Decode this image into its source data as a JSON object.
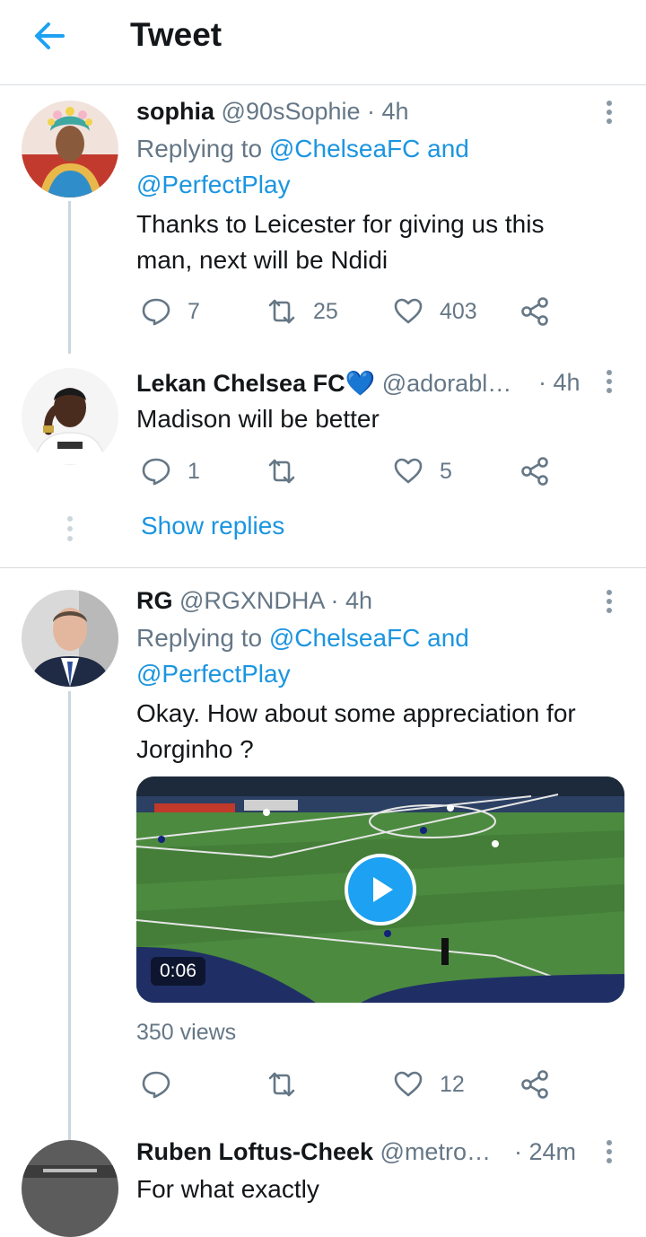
{
  "header": {
    "title": "Tweet"
  },
  "tweets": [
    {
      "name": "sophia",
      "handle": "@90sSophie · 4h",
      "reply_prefix": "Replying to",
      "reply_mention": "@ChelseaFC and",
      "reply_mention2": "@PerfectPlay",
      "text_line1": "Thanks to Leicester for giving us this",
      "text_line2": "man, next will be Ndidi",
      "replies": "7",
      "retweets": "25",
      "likes": "403"
    },
    {
      "name": "Lekan Chelsea FC",
      "name_emoji": "💙",
      "handle": "@adorabl…",
      "time": "· 4h",
      "text_line1": "Madison will be better",
      "replies": "1",
      "retweets": "",
      "likes": "5"
    },
    {
      "name": "RG",
      "handle": "@RGXNDHA · 4h",
      "reply_prefix": "Replying to",
      "reply_mention": "@ChelseaFC and",
      "reply_mention2": "@PerfectPlay",
      "text_line1": "Okay. How about some appreciation for",
      "text_line2": "Jorginho ?",
      "video_duration": "0:06",
      "views": "350 views",
      "replies": "",
      "retweets": "",
      "likes": "12"
    },
    {
      "name": "Ruben Loftus-Cheek",
      "handle": "@metro…",
      "time": "· 24m",
      "text_line1": "For what exactly"
    }
  ],
  "show_replies": "Show replies",
  "colors": {
    "accent": "#1b95e0",
    "secondary_text": "#657786",
    "primary_text": "#14171a"
  },
  "icons": [
    "back-arrow-icon",
    "more-vertical-icon",
    "reply-icon",
    "retweet-icon",
    "like-icon",
    "share-icon",
    "play-icon"
  ]
}
